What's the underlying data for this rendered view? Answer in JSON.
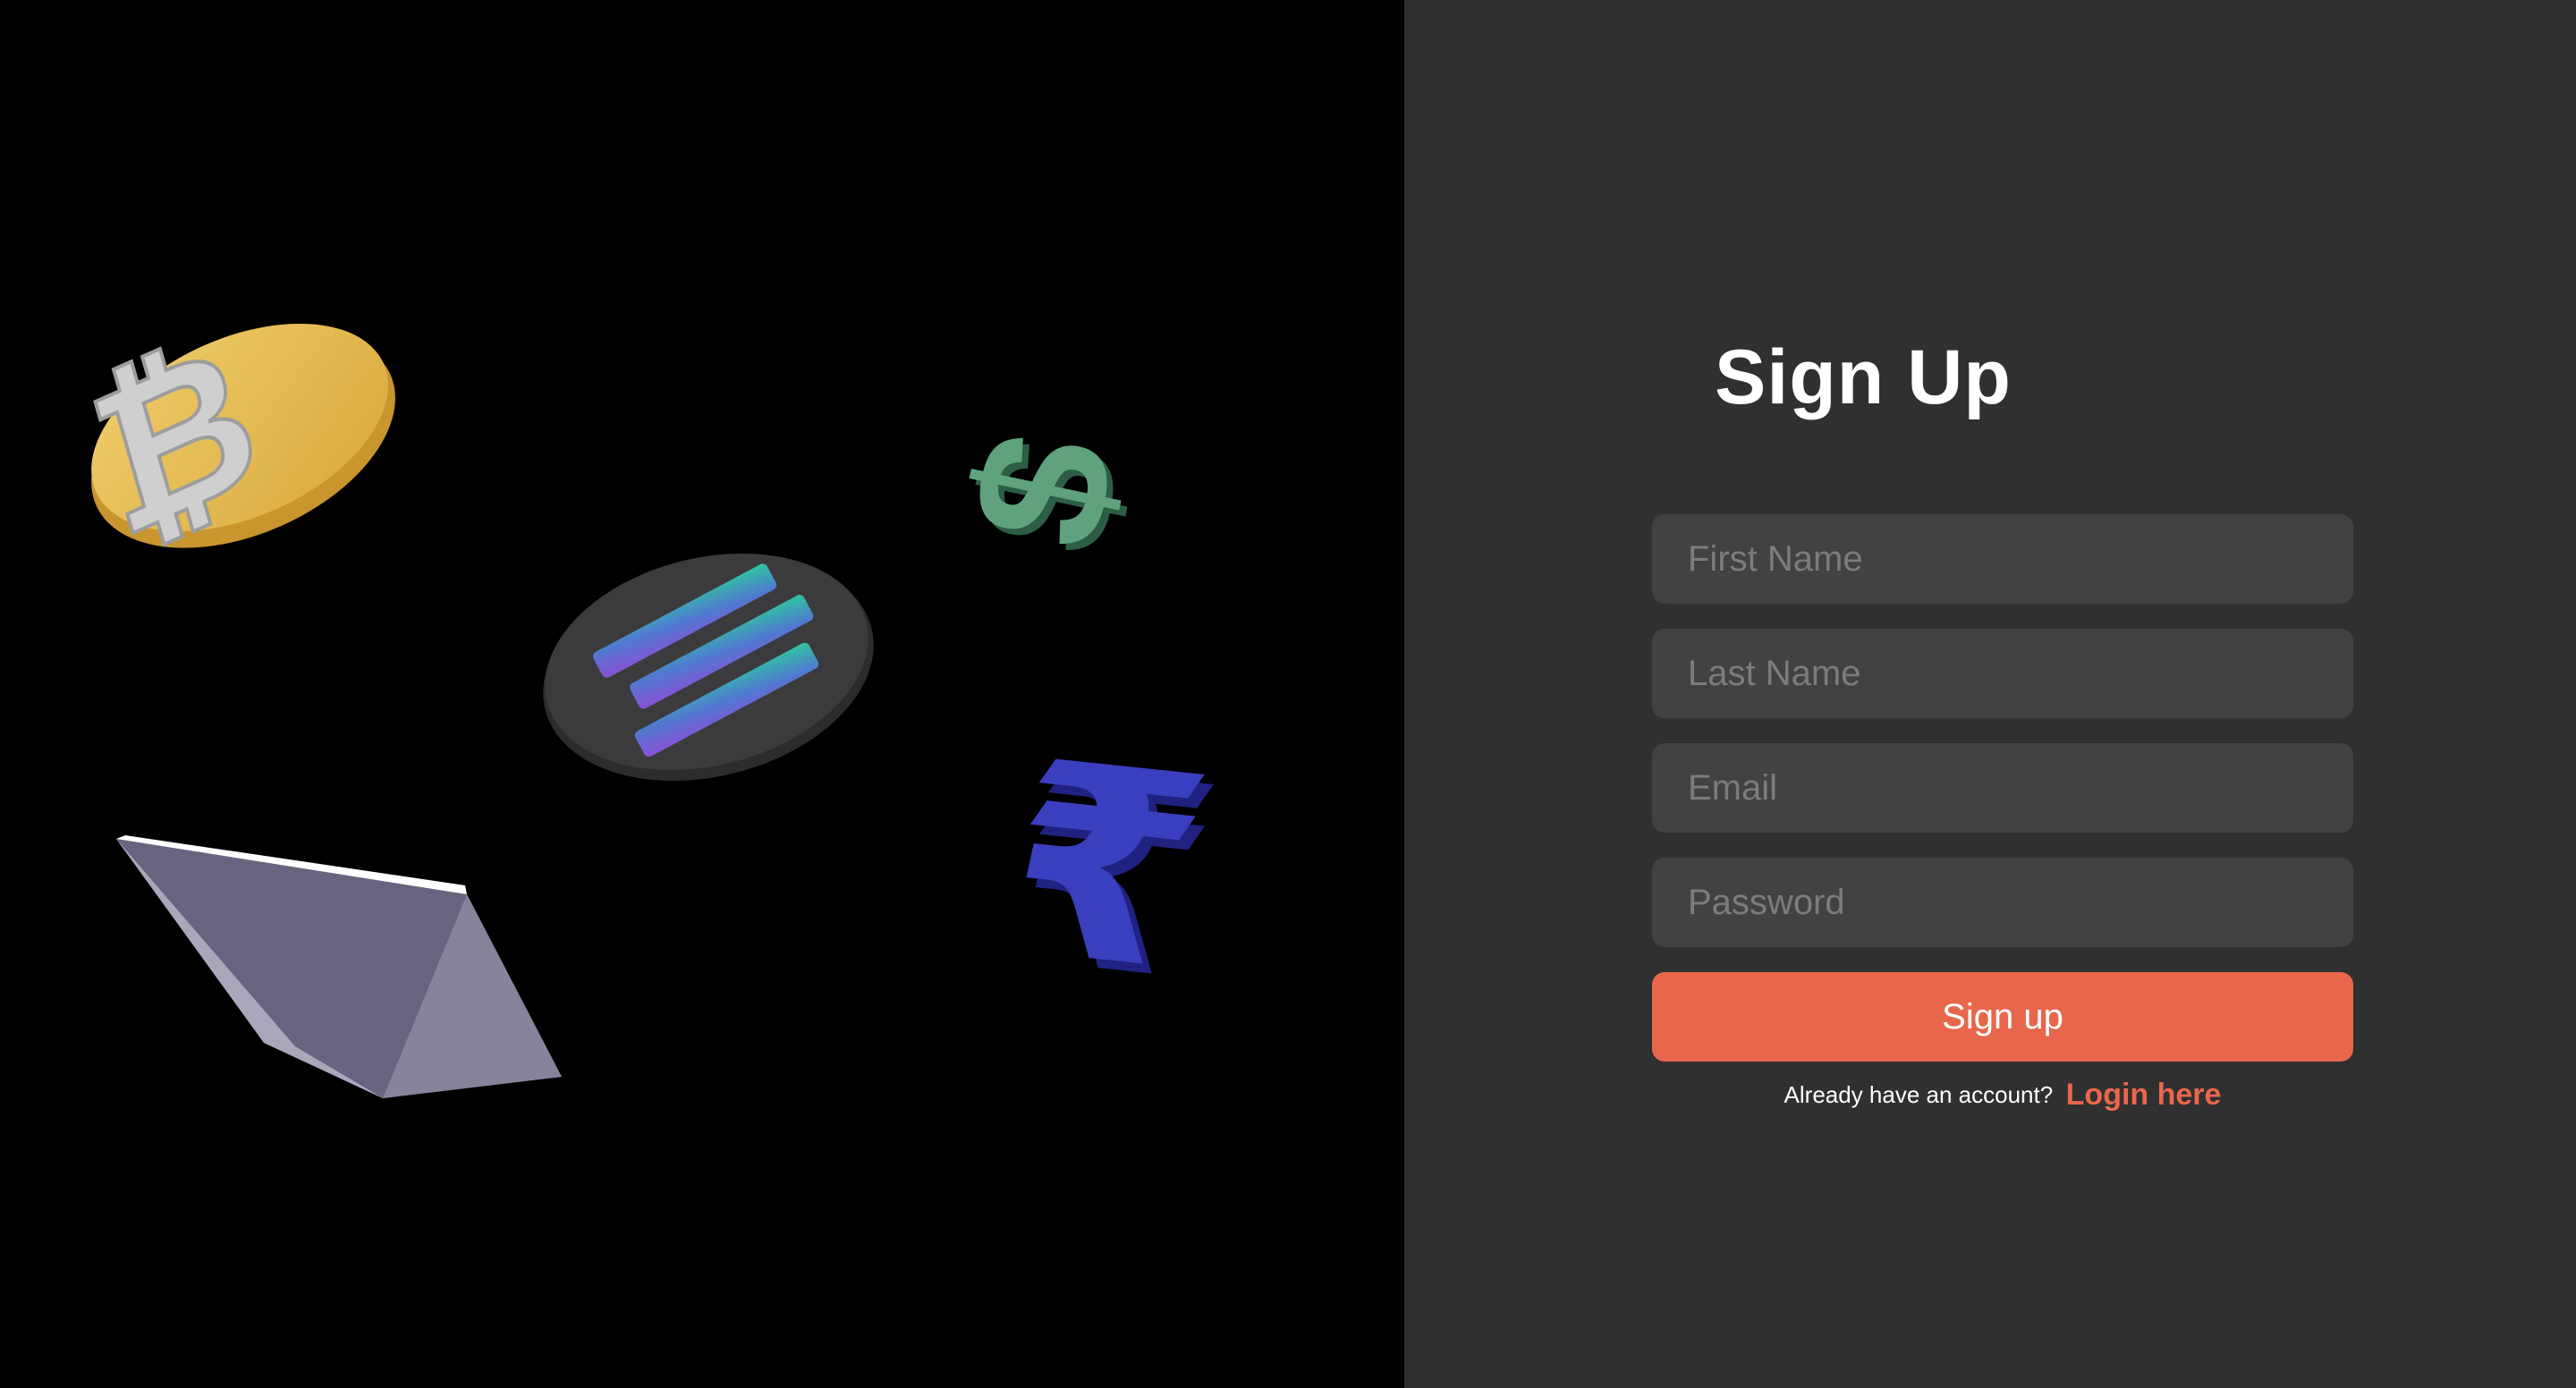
{
  "form": {
    "title": "Sign Up",
    "fields": {
      "first_name": {
        "placeholder": "First Name",
        "value": ""
      },
      "last_name": {
        "placeholder": "Last Name",
        "value": ""
      },
      "email": {
        "placeholder": "Email",
        "value": ""
      },
      "password": {
        "placeholder": "Password",
        "value": ""
      }
    },
    "submit_label": "Sign up",
    "login_prompt": "Already have an account?",
    "login_link": "Login here"
  },
  "illustration": {
    "icons": [
      "bitcoin-coin-icon",
      "dollar-sign-icon",
      "solana-coin-icon",
      "ethereum-crystal-icon",
      "rupee-sign-icon"
    ]
  },
  "colors": {
    "left_background": "#000000",
    "right_background": "#303030",
    "input_background": "#424242",
    "accent": "#e8674c",
    "placeholder": "#7c7c7c"
  }
}
